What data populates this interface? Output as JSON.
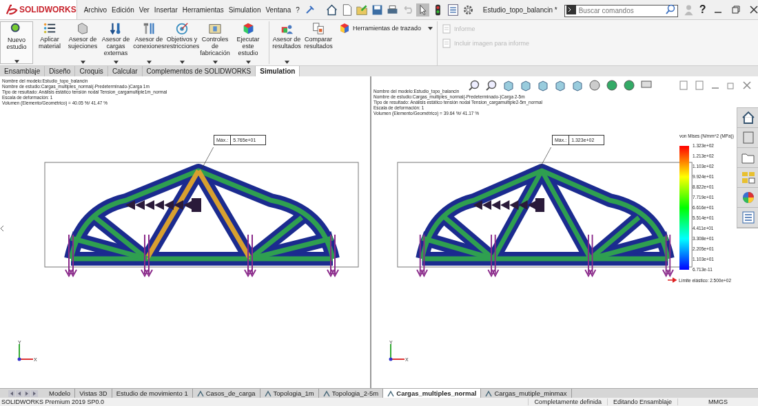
{
  "app": {
    "logo": "SOLIDWORKS"
  },
  "menu": [
    "Archivo",
    "Edición",
    "Ver",
    "Insertar",
    "Herramientas",
    "Simulation",
    "Ventana",
    "?"
  ],
  "document_title": "Estudio_topo_balancin *",
  "search": {
    "placeholder": "Buscar comandos"
  },
  "help": "?",
  "ribbon": {
    "tools": [
      {
        "label": "Nuevo estudio",
        "dropdown": true
      },
      {
        "label": "Aplicar material",
        "dropdown": false
      },
      {
        "label": "Asesor de sujeciones",
        "dropdown": true
      },
      {
        "label": "Asesor de cargas externas",
        "dropdown": true
      },
      {
        "label": "Asesor de conexiones",
        "dropdown": true
      },
      {
        "label": "Objetivos y restricciones",
        "dropdown": true
      },
      {
        "label": "Controles de fabricación",
        "dropdown": true
      },
      {
        "label": "Ejecutar este estudio",
        "dropdown": true
      },
      {
        "label": "Asesor de resultados",
        "dropdown": true
      },
      {
        "label": "Comparar resultados",
        "dropdown": false
      }
    ],
    "plot_tools": "Herramientas de trazado",
    "report": [
      {
        "label": "Informe",
        "disabled": true
      },
      {
        "label": "Incluir imagen para informe",
        "disabled": true
      }
    ]
  },
  "tabs": [
    {
      "label": "Ensamblaje",
      "selected": false
    },
    {
      "label": "Diseño",
      "selected": false
    },
    {
      "label": "Croquis",
      "selected": false
    },
    {
      "label": "Calcular",
      "selected": false
    },
    {
      "label": "Complementos de SOLIDWORKS",
      "selected": false
    },
    {
      "label": "Simulation",
      "selected": true
    }
  ],
  "viewports": [
    {
      "info": [
        "Nombre del modelo:Estudio_topo_balancin",
        "Nombre de estudio:Cargas_multiples_normal(-Predeterminado-)Carga 1m",
        "Tipo de resultado: Análisis estático tensión nodal Tension_cargamultiple1m_normal",
        "Escala de deformación: 1",
        "Volumen (Elemento/Geométrico) = 40.05 %/ 41.47 %"
      ],
      "max": {
        "label": "Máx.:",
        "value": "5.765e+01"
      },
      "triad": [
        "Y",
        "X"
      ]
    },
    {
      "info": [
        "Nombre del modelo:Estudio_topo_balancin",
        "Nombre de estudio:Cargas_multiples_normal(-Predeterminado-)Carga 2-5m",
        "Tipo de resultado: Análisis estático tensión nodal Tension_cargamultiple2-5m_normal",
        "Escala de deformación: 1",
        "Volumen (Elemento/Geométrico) = 39.64 %/ 41.17 %"
      ],
      "max": {
        "label": "Máx.:",
        "value": "1.323e+02"
      },
      "triad": [
        "Y",
        "X"
      ]
    }
  ],
  "legend": {
    "title": "von Mises (N/mm^2 (MPa))",
    "ticks": [
      "1.323e+02",
      "1.213e+02",
      "1.103e+02",
      "9.924e+01",
      "8.822e+01",
      "7.719e+01",
      "6.616e+01",
      "5.514e+01",
      "4.411e+01",
      "3.308e+01",
      "2.205e+01",
      "1.103e+01",
      "6.713e-11"
    ],
    "yield": "Límite elástico: 2.500e+02"
  },
  "sheet_tabs": [
    {
      "label": "Modelo",
      "selected": false,
      "icon": false
    },
    {
      "label": "Vistas 3D",
      "selected": false,
      "icon": false
    },
    {
      "label": "Estudio de movimiento 1",
      "selected": false,
      "icon": false
    },
    {
      "label": "Casos_de_carga",
      "selected": false,
      "icon": true
    },
    {
      "label": "Topologia_1m",
      "selected": false,
      "icon": true
    },
    {
      "label": "Topologia_2-5m",
      "selected": false,
      "icon": true
    },
    {
      "label": "Cargas_multiples_normal",
      "selected": true,
      "icon": true
    },
    {
      "label": "Cargas_mutiple_minmax",
      "selected": false,
      "icon": true
    }
  ],
  "status_bar": {
    "product": "SOLIDWORKS Premium 2019 SP0.0",
    "items": [
      "Completamente definida",
      "Editando Ensamblaje",
      "MMGS"
    ]
  }
}
